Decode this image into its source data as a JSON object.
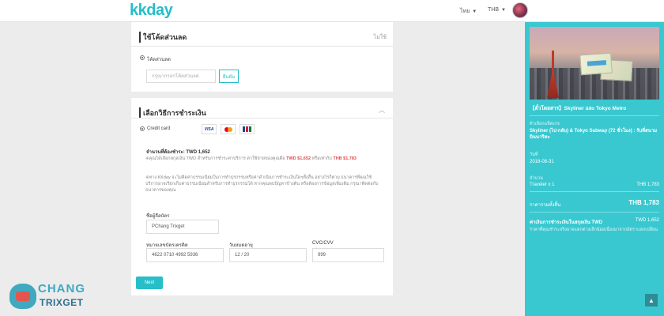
{
  "header": {
    "logo": "kkday",
    "language": "ไทย",
    "currency": "THB"
  },
  "promo": {
    "title": "ใช้โค้ดส่วนลด",
    "toggle": "ไม่ใช้",
    "radio_label": "โค้ดส่วนลด",
    "input_placeholder": "กรุณากรอกโค้ดส่วนลด",
    "apply_button": "ยืนยัน"
  },
  "payment": {
    "title": "เลือกวิธีการชำระเงิน",
    "method_label": "Credit card",
    "card_brands": [
      "VISA",
      "MasterCard",
      "JCB"
    ],
    "amount_label": "จำนวนที่ต้องชำระ: TWD 1,652",
    "note1_prefix": "※คุณได้เลือกสกุลเงิน TWD สำหรับการชำระค่าบริการ ค่าใช้จ่ายของคุณคือ",
    "note1_amount": "TWD $1,652",
    "note1_mid": "หรือเท่ากับ",
    "note1_amount2": "THB $1,783",
    "note2": "※ทาง KKday จะไม่คิดค่าธรรมเนียมในการทำธุรกรรมหรือค่าดำเนินการชำระเงินใดๆทั้งสิ้น อย่างไรก็ตาม ธนาคารที่คุณใช้บริการอาจเรียกเก็บค่าธรรมเนียมสำหรับการทำธุรกรรมได้ หากคุณพบปัญหาข้างต้น หรือต้องการข้อมูลเพิ่มเติม กรุณาติดต่อกับธนาคารของคุณ",
    "cardholder_label": "ชื่อผู้ถือบัตร",
    "cardholder_value": "PChang Trixget",
    "card_number_label": "หมายเลขบัตรเครดิต",
    "card_number_value": "4622 0710 4992 5936",
    "expiry_label": "วันหมดอายุ",
    "expiry_value": "12 / 20",
    "cvc_label": "CVC/CVV",
    "cvc_value": "999",
    "next_button": "Next"
  },
  "summary": {
    "product_title": "【ตั๋วโดยสาร】Skyliner และ Tokyo Metro",
    "package_label": "ตัวเลือกแพ็คเกจ",
    "package_value": "Skyliner (ไป-กลับ) & Tokyo Subway (72 ชั่วโมง) : รับที่สนามบินนาริตะ",
    "date_label": "วันที่",
    "date_value": "2018-08-31",
    "qty_label": "จำนวน",
    "qty_value": "Traveler x 1",
    "qty_price": "THB 1,783",
    "total_label": "ราคารวมทั้งสิ้น",
    "total_value": "THB 1,783",
    "pay_label": "ค่าเงินการชำระเงินในสกุลเงิน TWD",
    "pay_value": "TWD 1,652",
    "pay_note": "ราคาที่คุณชำระจริงอาจแตกต่างเล็กน้อยเนื่องมาจากอัตราแลกเปลี่ยน"
  },
  "watermark": {
    "line1": "CHANG",
    "line2": "TRIXGET"
  },
  "colors": {
    "brand": "#26bec9",
    "sidebar": "#3ac8d0",
    "warning": "#e04a4a"
  }
}
